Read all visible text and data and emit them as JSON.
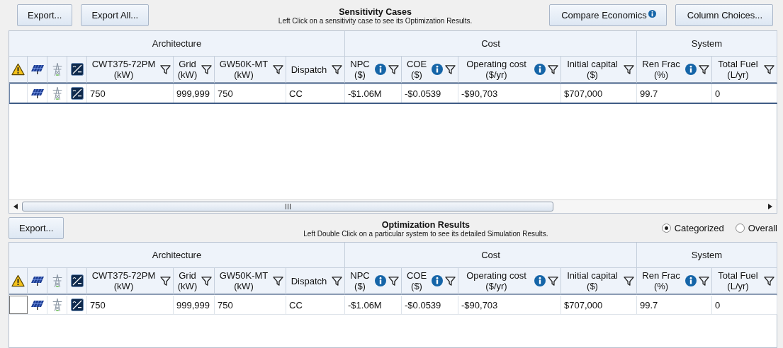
{
  "panels": [
    {
      "left_buttons": [
        "Export...",
        "Export All..."
      ],
      "title": "Sensitivity Cases",
      "subtitle": "Left Click on a sensitivity case to see its Optimization Results.",
      "right_items": [
        {
          "kind": "button",
          "label": "Compare Economics",
          "info": true
        },
        {
          "kind": "button",
          "label": "Column Choices...",
          "info": false
        }
      ],
      "groups": [
        {
          "label": "Architecture",
          "columns": [
            {
              "kind": "warning"
            },
            {
              "kind": "panel"
            },
            {
              "kind": "tower"
            },
            {
              "kind": "converter"
            },
            {
              "kind": "value",
              "name": "CWT375-72PM",
              "unit": "(kW)",
              "info": false
            },
            {
              "kind": "value",
              "name": "Grid",
              "unit": "(kW)",
              "info": false
            },
            {
              "kind": "value",
              "name": "GW50K-MT",
              "unit": "(kW)",
              "info": false
            },
            {
              "kind": "value",
              "name": "Dispatch",
              "info": false
            }
          ]
        },
        {
          "label": "Cost",
          "columns": [
            {
              "kind": "value",
              "name": "NPC",
              "unit": "($)",
              "info": true
            },
            {
              "kind": "value",
              "name": "COE",
              "unit": "($)",
              "info": true
            },
            {
              "kind": "value",
              "name": "Operating cost",
              "unit": "($/yr)",
              "info": true
            },
            {
              "kind": "value",
              "name": "Initial capital",
              "unit": "($)",
              "info": false
            }
          ]
        },
        {
          "label": "System",
          "columns": [
            {
              "kind": "value",
              "name": "Ren Frac",
              "unit": "(%)",
              "info": true
            },
            {
              "kind": "value",
              "name": "Total Fuel",
              "unit": "(L/yr)",
              "info": false
            }
          ]
        }
      ],
      "rows": [
        {
          "selected": true,
          "cells": [
            "",
            "",
            "",
            "",
            "750",
            "999,999",
            "750",
            "CC",
            "-$1.06M",
            "-$0.0539",
            "-$90,703",
            "$707,000",
            "99.7",
            "0"
          ]
        }
      ]
    },
    {
      "left_buttons": [
        "Export..."
      ],
      "title": "Optimization Results",
      "subtitle": "Left Double Click on a particular system to see its detailed Simulation Results.",
      "right_items": [
        {
          "kind": "radio",
          "label": "Categorized",
          "selected": true
        },
        {
          "kind": "radio",
          "label": "Overall",
          "selected": false
        }
      ],
      "groups": [
        {
          "label": "Architecture",
          "columns": [
            {
              "kind": "warning"
            },
            {
              "kind": "panel"
            },
            {
              "kind": "tower"
            },
            {
              "kind": "converter"
            },
            {
              "kind": "value",
              "name": "CWT375-72PM",
              "unit": "(kW)",
              "info": false
            },
            {
              "kind": "value",
              "name": "Grid",
              "unit": "(kW)",
              "info": false
            },
            {
              "kind": "value",
              "name": "GW50K-MT",
              "unit": "(kW)",
              "info": false
            },
            {
              "kind": "value",
              "name": "Dispatch",
              "info": false
            }
          ]
        },
        {
          "label": "Cost",
          "columns": [
            {
              "kind": "value",
              "name": "NPC",
              "unit": "($)",
              "info": true
            },
            {
              "kind": "value",
              "name": "COE",
              "unit": "($)",
              "info": true
            },
            {
              "kind": "value",
              "name": "Operating cost",
              "unit": "($/yr)",
              "info": true
            },
            {
              "kind": "value",
              "name": "Initial capital",
              "unit": "($)",
              "info": false
            }
          ]
        },
        {
          "label": "System",
          "columns": [
            {
              "kind": "value",
              "name": "Ren Frac",
              "unit": "(%)",
              "info": true
            },
            {
              "kind": "value",
              "name": "Total Fuel",
              "unit": "(L/yr)",
              "info": false
            }
          ]
        }
      ],
      "rows": [
        {
          "selected": false,
          "cells": [
            "",
            "",
            "",
            "",
            "750",
            "999,999",
            "750",
            "CC",
            "-$1.06M",
            "-$0.0539",
            "-$90,703",
            "$707,000",
            "99.7",
            "0"
          ]
        }
      ]
    }
  ]
}
